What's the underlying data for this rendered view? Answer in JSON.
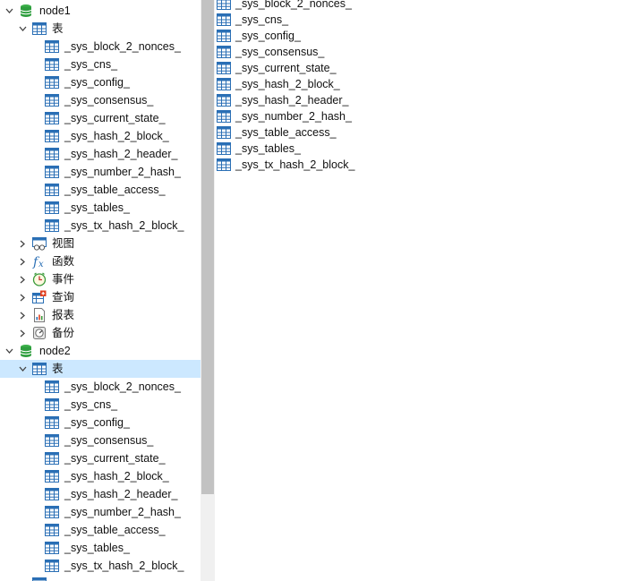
{
  "tree": {
    "nodes": [
      {
        "name": "node1",
        "category_tables": "表",
        "tables": [
          "_sys_block_2_nonces_",
          "_sys_cns_",
          "_sys_config_",
          "_sys_consensus_",
          "_sys_current_state_",
          "_sys_hash_2_block_",
          "_sys_hash_2_header_",
          "_sys_number_2_hash_",
          "_sys_table_access_",
          "_sys_tables_",
          "_sys_tx_hash_2_block_"
        ],
        "other_categories": [
          {
            "label": "视图",
            "icon": "view-icon"
          },
          {
            "label": "函数",
            "icon": "function-icon"
          },
          {
            "label": "事件",
            "icon": "event-clock-icon"
          },
          {
            "label": "查询",
            "icon": "query-icon"
          },
          {
            "label": "报表",
            "icon": "report-icon"
          },
          {
            "label": "备份",
            "icon": "backup-icon"
          }
        ]
      },
      {
        "name": "node2",
        "category_tables": "表",
        "tables": [
          "_sys_block_2_nonces_",
          "_sys_cns_",
          "_sys_config_",
          "_sys_consensus_",
          "_sys_current_state_",
          "_sys_hash_2_block_",
          "_sys_hash_2_header_",
          "_sys_number_2_hash_",
          "_sys_table_access_",
          "_sys_tables_",
          "_sys_tx_hash_2_block_"
        ]
      }
    ]
  },
  "list": {
    "items": [
      "_sys_block_2_nonces_",
      "_sys_cns_",
      "_sys_config_",
      "_sys_consensus_",
      "_sys_current_state_",
      "_sys_hash_2_block_",
      "_sys_hash_2_header_",
      "_sys_number_2_hash_",
      "_sys_table_access_",
      "_sys_tables_",
      "_sys_tx_hash_2_block_"
    ]
  },
  "colors": {
    "selection": "#cce8ff",
    "db_icon": "#2e9e3e",
    "table_icon": "#2a6fb5"
  }
}
